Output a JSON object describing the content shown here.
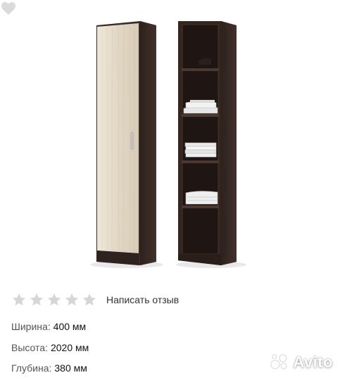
{
  "product": {
    "favorite_icon": "heart-icon",
    "rating": {
      "stars": 5,
      "filled": 0,
      "icon": "star-icon",
      "color": "#d6d6d6"
    },
    "review_link": "Написать отзыв",
    "specs": [
      {
        "label": "Ширина:",
        "value": "400 мм"
      },
      {
        "label": "Высота:",
        "value": "2020 мм"
      },
      {
        "label": "Глубина:",
        "value": "380 мм"
      }
    ],
    "watermark": "Avito",
    "colors": {
      "wenge": "#3a2a25",
      "light_oak": "#e6dccb",
      "star_empty": "#d6d6d6"
    }
  }
}
